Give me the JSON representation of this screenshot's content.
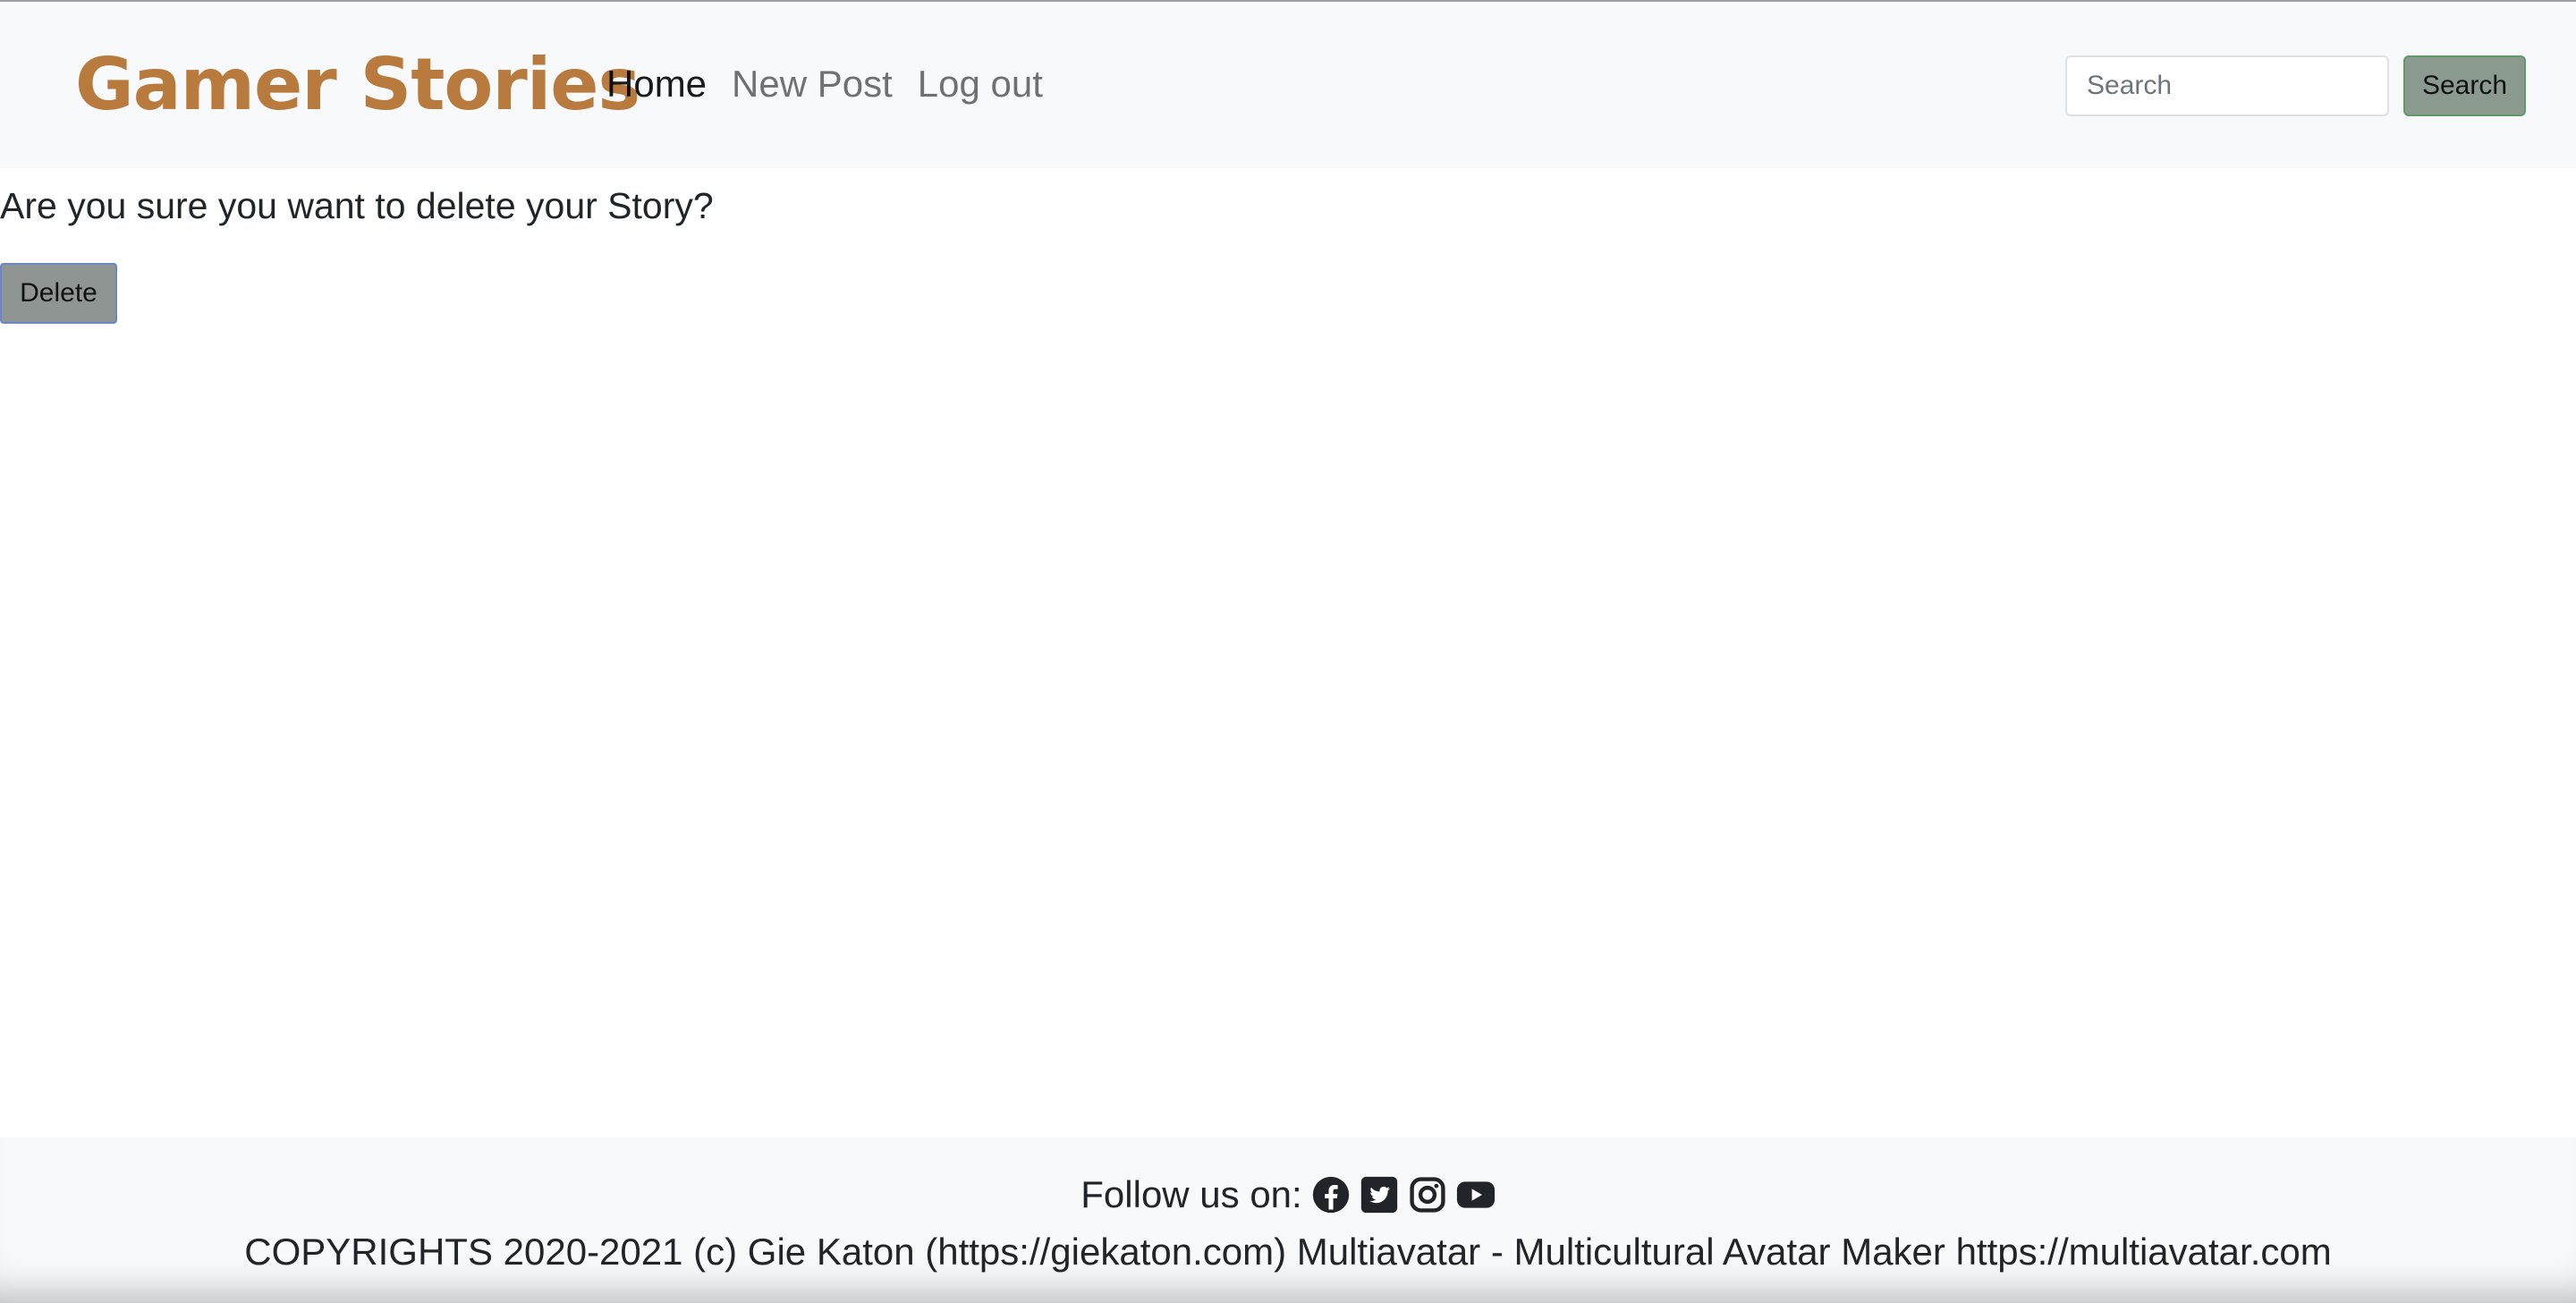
{
  "navbar": {
    "brand": "Gamer Stories",
    "links": [
      {
        "label": "Home",
        "active": true
      },
      {
        "label": "New Post",
        "active": false
      },
      {
        "label": "Log out",
        "active": false
      }
    ],
    "search": {
      "placeholder": "Search",
      "value": "",
      "button_label": "Search"
    }
  },
  "main": {
    "question": "Are you sure you want to delete your Story?",
    "delete_label": "Delete"
  },
  "footer": {
    "follow_label": "Follow us on:",
    "social_icons": [
      "facebook-icon",
      "twitter-icon",
      "instagram-icon",
      "youtube-icon"
    ],
    "copyright": "COPYRIGHTS 2020-2021 (c) Gie Katon (https://giekaton.com) Multiavatar - Multicultural Avatar Maker https://multiavatar.com"
  },
  "colors": {
    "brand": "#b87a3d",
    "navbar_bg": "#f8f9fa",
    "search_button_bg": "#8a9a8f",
    "search_button_border": "#5f9b66",
    "delete_button_bg": "#8e9593",
    "delete_button_border": "#6f86c6"
  }
}
